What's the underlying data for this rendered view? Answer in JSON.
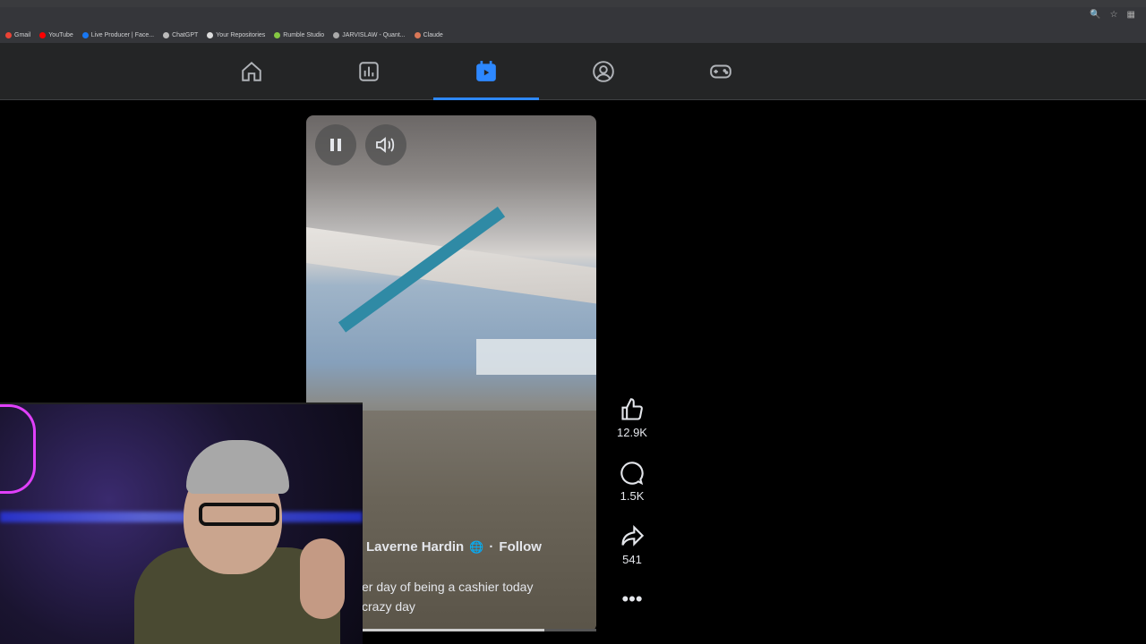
{
  "browser": {
    "bookmarks": [
      {
        "label": "Gmail",
        "color": "#ea4335"
      },
      {
        "label": "YouTube",
        "color": "#ff0000"
      },
      {
        "label": "Live Producer | Face...",
        "color": "#1877f2"
      },
      {
        "label": "ChatGPT",
        "color": "#bbbbbb"
      },
      {
        "label": "Your Repositories",
        "color": "#dddddd"
      },
      {
        "label": "Rumble Studio",
        "color": "#85c742"
      },
      {
        "label": "JARVISLAW - Quant...",
        "color": "#aaaaaa"
      },
      {
        "label": "Claude",
        "color": "#d97757"
      }
    ]
  },
  "nav": {
    "tabs": [
      {
        "name": "home",
        "active": false
      },
      {
        "name": "dashboard",
        "active": false
      },
      {
        "name": "reels",
        "active": true
      },
      {
        "name": "profile",
        "active": false
      },
      {
        "name": "gaming",
        "active": false
      }
    ],
    "accent": "#2d88ff"
  },
  "reel": {
    "author": "Laverne Hardin",
    "follow_label": "Follow",
    "caption_line1": "er day of being a cashier today",
    "caption_line2": "crazy day",
    "progress": 0.78,
    "likes": "12.9K",
    "comments": "1.5K",
    "shares": "541"
  }
}
